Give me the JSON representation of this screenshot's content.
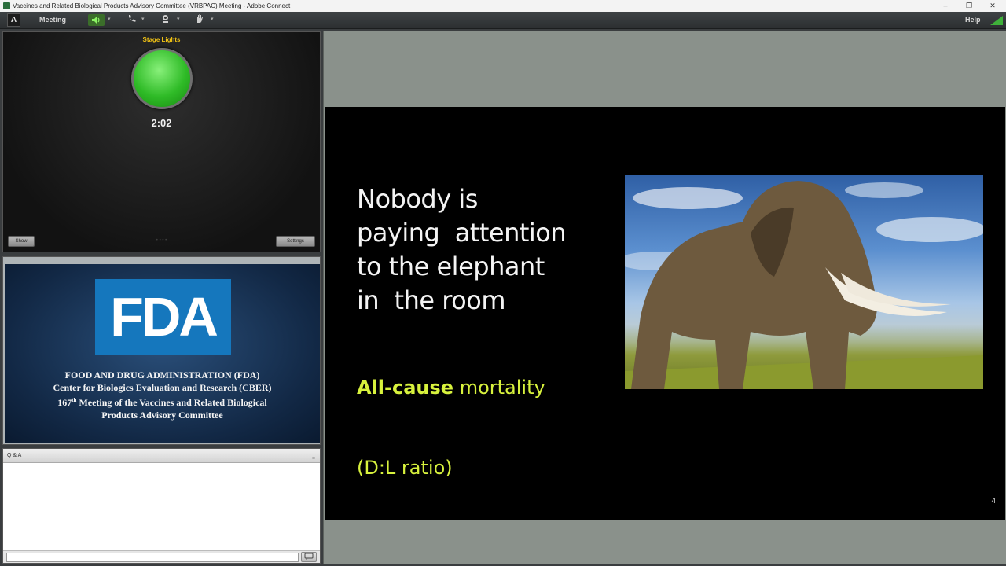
{
  "window": {
    "title": "Vaccines and Related Biological Products Advisory Committee (VRBPAC) Meeting - Adobe Connect",
    "controls": [
      "–",
      "❐",
      "✕"
    ]
  },
  "menubar": {
    "logo": "A",
    "meeting_label": "Meeting",
    "help_label": "Help",
    "icons": [
      "speaker-icon",
      "phone-icon",
      "webcam-icon",
      "raise-hand-icon",
      "connection-status-icon"
    ]
  },
  "stage_lights": {
    "title": "Stage Lights",
    "timer": "2:02",
    "left_button": "Show",
    "right_button": "Settings",
    "middle_text": "• • • •",
    "light_color": "#2fbb27"
  },
  "fda_pod": {
    "logo_text": "FDA",
    "line1": "FOOD AND DRUG ADMINISTRATION (FDA)",
    "line2": "Center for Biologics Evaluation and Research (CBER)",
    "line3_number": "167",
    "line3_sup": "th",
    "line3_rest": " Meeting of the Vaccines and Related Biological",
    "line4": "Products Advisory Committee"
  },
  "qa_pod": {
    "title": "Q & A",
    "header_button": "≡",
    "input_value": "",
    "send_icon": "send-icon"
  },
  "main_slide": {
    "heading_lines": [
      "Nobody is",
      "paying  attention",
      "to the elephant",
      "in  the room"
    ],
    "sub_bold": "All-cause",
    "sub_rest": " mortality",
    "sub_line2": "(D:L ratio)",
    "page_number": "4",
    "accent_color": "#d8f23d"
  }
}
